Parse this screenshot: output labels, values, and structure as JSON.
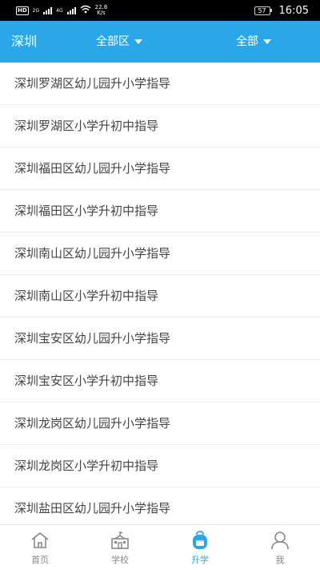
{
  "status_bar": {
    "hd": "HD",
    "net1": "2G",
    "net2": "4G",
    "speed_value": "22.8",
    "speed_unit": "K/s",
    "battery": "57",
    "time": "16:05"
  },
  "header": {
    "city": "深圳",
    "district_filter": "全部区",
    "type_filter": "全部"
  },
  "list": {
    "items": [
      "深圳罗湖区幼儿园升小学指导",
      "深圳罗湖区小学升初中指导",
      "深圳福田区幼儿园升小学指导",
      "深圳福田区小学升初中指导",
      "深圳南山区幼儿园升小学指导",
      "深圳南山区小学升初中指导",
      "深圳宝安区幼儿园升小学指导",
      "深圳宝安区小学升初中指导",
      "深圳龙岗区幼儿园升小学指导",
      "深圳龙岗区小学升初中指导",
      "深圳盐田区幼儿园升小学指导"
    ]
  },
  "bottom_nav": {
    "home": "首页",
    "school": "学校",
    "upgrade": "升学",
    "me": "我"
  },
  "colors": {
    "accent": "#2aa7e8",
    "text": "#444444",
    "nav_inactive": "#888888"
  }
}
